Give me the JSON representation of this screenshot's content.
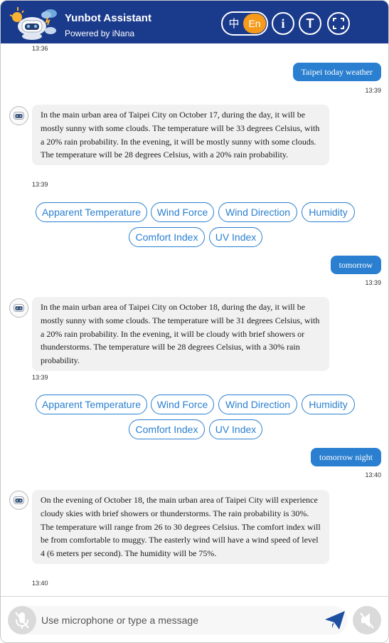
{
  "header": {
    "title": "Yunbot Assistant",
    "subtitle": "Powered by iNana",
    "lang_zh": "中",
    "lang_en": "En",
    "info_glyph": "i",
    "text_glyph": "T"
  },
  "colors": {
    "header_bg": "#1a3a8c",
    "accent": "#2a7fd0",
    "active_lang": "#f59a1a",
    "bot_bubble": "#f1f1f1"
  },
  "messages": {
    "ts0": "13:36",
    "user1": {
      "text": "Taipei today weather",
      "time": "13:39"
    },
    "bot1": {
      "text": "In the main urban area of Taipei City on October 17, during the day, it will be mostly sunny with some clouds. The temperature will be 33 degrees Celsius, with a 20% rain probability. In the evening, it will be mostly sunny with some clouds. The temperature will be 28 degrees Celsius, with a 20% rain probability.",
      "time": "13:39"
    },
    "user2": {
      "text": "tomorrow",
      "time": "13:39"
    },
    "bot2": {
      "text": "In the main urban area of Taipei City on October 18, during the day, it will be mostly sunny with some clouds. The temperature will be 31 degrees Celsius, with a 20% rain probability. In the evening, it will be cloudy with brief showers or thunderstorms. The temperature will be 28 degrees Celsius, with a 30% rain probability.",
      "time": "13:39"
    },
    "user3": {
      "text": "tomorrow night",
      "time": "13:40"
    },
    "bot3": {
      "text": "On the evening of October 18, the main urban area of Taipei City will experience cloudy skies with brief showers or thunderstorms. The rain probability is 30%. The temperature will range from 26 to 30 degrees Celsius. The comfort index will be from comfortable to muggy. The easterly wind will have a wind speed of level 4 (6 meters per second). The humidity will be 75%.",
      "time": "13:40"
    }
  },
  "chips": {
    "apparent": "Apparent Temperature",
    "wind_force": "Wind Force",
    "wind_direction": "Wind Direction",
    "humidity": "Humidity",
    "comfort": "Comfort Index",
    "uv": "UV Index"
  },
  "footer": {
    "placeholder": "Use microphone or type a message"
  },
  "icons": {
    "logo": "weather-robot-logo-icon",
    "info": "info-icon",
    "text_size": "text-size-icon",
    "fullscreen": "fullscreen-icon",
    "mic": "microphone-off-icon",
    "send": "send-icon",
    "mute": "speaker-mute-icon",
    "avatar": "bot-avatar-icon"
  }
}
